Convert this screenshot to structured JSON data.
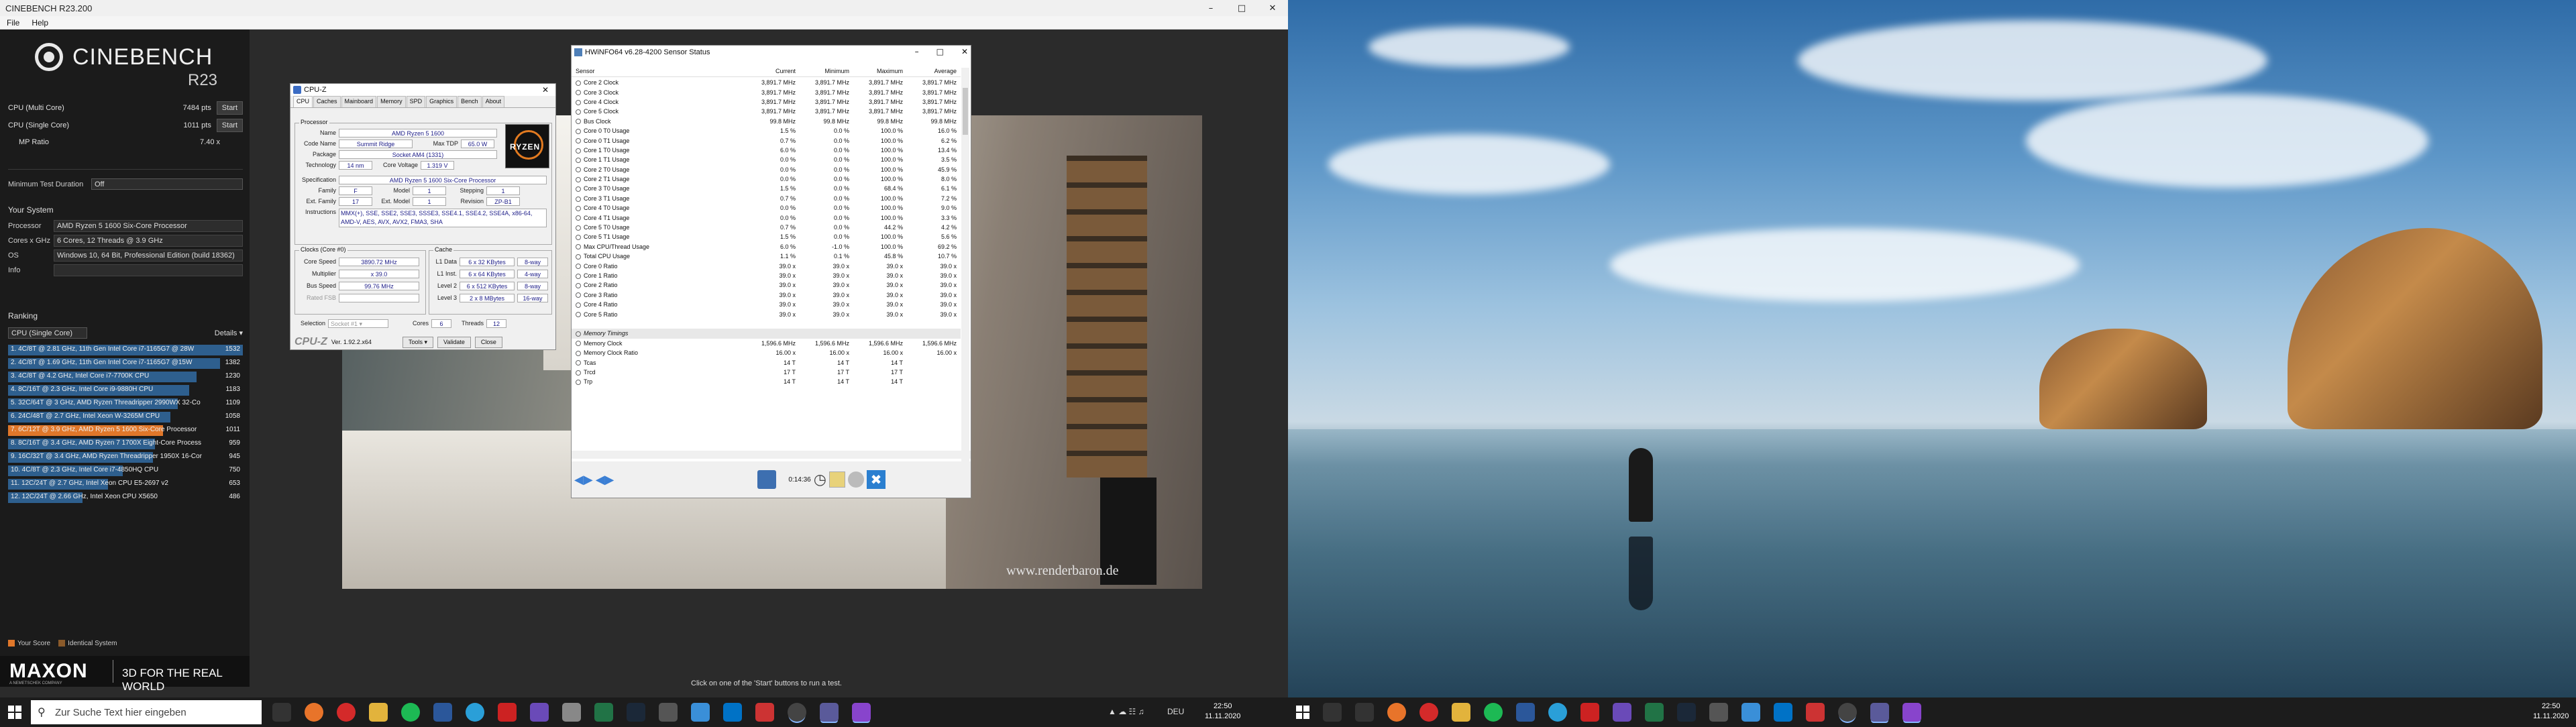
{
  "cinebench": {
    "window_title": "CINEBENCH R23.200",
    "menu": [
      "File",
      "Help"
    ],
    "logo_text": "CINEBENCH",
    "version": "R23",
    "multi_label": "CPU (Multi Core)",
    "multi_score": "7484 pts",
    "single_label": "CPU (Single Core)",
    "single_score": "1011 pts",
    "start_label": "Start",
    "mp_label": "MP Ratio",
    "mp_value": "7.40 x",
    "min_test_label": "Minimum Test Duration",
    "min_test_value": "Off",
    "your_system": "Your System",
    "system": [
      {
        "k": "Processor",
        "v": "AMD Ryzen 5 1600 Six-Core Processor"
      },
      {
        "k": "Cores x GHz",
        "v": "6 Cores, 12 Threads @ 3.9 GHz"
      },
      {
        "k": "OS",
        "v": "Windows 10, 64 Bit, Professional Edition (build 18362)"
      },
      {
        "k": "Info",
        "v": ""
      }
    ],
    "ranking_title": "Ranking",
    "ranking_select": "CPU (Single Core)",
    "details_label": "Details",
    "ranking": [
      {
        "text": "1. 4C/8T @ 2.81 GHz, 11th Gen Intel Core i7-1165G7 @ 28W",
        "score": 1532,
        "mine": false
      },
      {
        "text": "2. 4C/8T @ 1.69 GHz, 11th Gen Intel Core i7-1165G7 @15W",
        "score": 1382,
        "mine": false
      },
      {
        "text": "3. 4C/8T @ 4.2 GHz, Intel Core i7-7700K CPU",
        "score": 1230,
        "mine": false
      },
      {
        "text": "4. 8C/16T @ 2.3 GHz, Intel Core i9-9880H CPU",
        "score": 1183,
        "mine": false
      },
      {
        "text": "5. 32C/64T @ 3 GHz, AMD Ryzen Threadripper 2990WX 32-Co",
        "score": 1109,
        "mine": false
      },
      {
        "text": "6. 24C/48T @ 2.7 GHz, Intel Xeon W-3265M CPU",
        "score": 1058,
        "mine": false
      },
      {
        "text": "7. 6C/12T @ 3.9 GHz, AMD Ryzen 5 1600 Six-Core Processor",
        "score": 1011,
        "mine": true
      },
      {
        "text": "8. 8C/16T @ 3.4 GHz, AMD Ryzen 7 1700X Eight-Core Process",
        "score": 959,
        "mine": false
      },
      {
        "text": "9. 16C/32T @ 3.4 GHz, AMD Ryzen Threadripper 1950X 16-Cor",
        "score": 945,
        "mine": false
      },
      {
        "text": "10. 4C/8T @ 2.3 GHz, Intel Core i7-4850HQ CPU",
        "score": 750,
        "mine": false
      },
      {
        "text": "11. 12C/24T @ 2.7 GHz, Intel Xeon CPU E5-2697 v2",
        "score": 653,
        "mine": false
      },
      {
        "text": "12. 12C/24T @ 2.66 GHz, Intel Xeon CPU X5650",
        "score": 486,
        "mine": false
      }
    ],
    "legend_your": "Your Score",
    "legend_identical": "Identical System",
    "brand": "MAXON",
    "brand_sub": "A NEMETSCHEK COMPANY",
    "brand_tag": "3D FOR THE REAL WORLD",
    "status": "Click on one of the 'Start' buttons to run a test.",
    "watermark": "www.renderbaron.de",
    "colors": {
      "bar": "#2e5f8e",
      "mine": "#e0772a",
      "identical": "#8a5a2a"
    }
  },
  "cpuz": {
    "title": "CPU-Z",
    "tabs": [
      "CPU",
      "Caches",
      "Mainboard",
      "Memory",
      "SPD",
      "Graphics",
      "Bench",
      "About"
    ],
    "processor_group": "Processor",
    "name_label": "Name",
    "name": "AMD Ryzen 5 1600",
    "codename_label": "Code Name",
    "codename": "Summit Ridge",
    "maxtdp_label": "Max TDP",
    "maxtdp": "65.0 W",
    "package_label": "Package",
    "package": "Socket AM4 (1331)",
    "technology_label": "Technology",
    "technology": "14 nm",
    "corevoltage_label": "Core Voltage",
    "corevoltage": "1.319 V",
    "spec_label": "Specification",
    "spec": "AMD Ryzen 5 1600 Six-Core Processor",
    "family_label": "Family",
    "family": "F",
    "model_label": "Model",
    "model": "1",
    "stepping_label": "Stepping",
    "stepping": "1",
    "extfamily_label": "Ext. Family",
    "extfamily": "17",
    "extmodel_label": "Ext. Model",
    "extmodel": "1",
    "revision_label": "Revision",
    "revision": "ZP-B1",
    "instr_label": "Instructions",
    "instr": "MMX(+), SSE, SSE2, SSE3, SSSE3, SSE4.1, SSE4.2, SSE4A, x86-64, AMD-V, AES, AVX, AVX2, FMA3, SHA",
    "clocks_group": "Clocks (Core #0)",
    "corespeed_label": "Core Speed",
    "corespeed": "3890.72 MHz",
    "multiplier_label": "Multiplier",
    "multiplier": "x 39.0",
    "busspeed_label": "Bus Speed",
    "busspeed": "99.76 MHz",
    "ratedfsb_label": "Rated FSB",
    "cache_group": "Cache",
    "l1d_label": "L1 Data",
    "l1d": "6 x 32 KBytes",
    "l1d_way": "8-way",
    "l1i_label": "L1 Inst.",
    "l1i": "6 x 64 KBytes",
    "l1i_way": "4-way",
    "l2_label": "Level 2",
    "l2": "6 x 512 KBytes",
    "l2_way": "8-way",
    "l3_label": "Level 3",
    "l3": "2 x 8 MBytes",
    "l3_way": "16-way",
    "selection_label": "Selection",
    "selection": "Socket #1",
    "cores_label": "Cores",
    "cores": "6",
    "threads_label": "Threads",
    "threads": "12",
    "footer_logo": "CPU-Z",
    "version": "Ver. 1.92.2.x64",
    "tools_label": "Tools",
    "validate_label": "Validate",
    "close_label": "Close",
    "badge": "RYZEN"
  },
  "hwinfo": {
    "title": "HWiNFO64 v6.28-4200 Sensor Status",
    "headers": [
      "Sensor",
      "Current",
      "Minimum",
      "Maximum",
      "Average"
    ],
    "rows": [
      [
        "Core 2 Clock",
        "3,891.7 MHz",
        "3,891.7 MHz",
        "3,891.7 MHz",
        "3,891.7 MHz"
      ],
      [
        "Core 3 Clock",
        "3,891.7 MHz",
        "3,891.7 MHz",
        "3,891.7 MHz",
        "3,891.7 MHz"
      ],
      [
        "Core 4 Clock",
        "3,891.7 MHz",
        "3,891.7 MHz",
        "3,891.7 MHz",
        "3,891.7 MHz"
      ],
      [
        "Core 5 Clock",
        "3,891.7 MHz",
        "3,891.7 MHz",
        "3,891.7 MHz",
        "3,891.7 MHz"
      ],
      [
        "Bus Clock",
        "99.8 MHz",
        "99.8 MHz",
        "99.8 MHz",
        "99.8 MHz"
      ],
      [
        "Core 0 T0 Usage",
        "1.5 %",
        "0.0 %",
        "100.0 %",
        "16.0 %"
      ],
      [
        "Core 0 T1 Usage",
        "0.7 %",
        "0.0 %",
        "100.0 %",
        "6.2 %"
      ],
      [
        "Core 1 T0 Usage",
        "6.0 %",
        "0.0 %",
        "100.0 %",
        "13.4 %"
      ],
      [
        "Core 1 T1 Usage",
        "0.0 %",
        "0.0 %",
        "100.0 %",
        "3.5 %"
      ],
      [
        "Core 2 T0 Usage",
        "0.0 %",
        "0.0 %",
        "100.0 %",
        "45.9 %"
      ],
      [
        "Core 2 T1 Usage",
        "0.0 %",
        "0.0 %",
        "100.0 %",
        "8.0 %"
      ],
      [
        "Core 3 T0 Usage",
        "1.5 %",
        "0.0 %",
        "68.4 %",
        "6.1 %"
      ],
      [
        "Core 3 T1 Usage",
        "0.7 %",
        "0.0 %",
        "100.0 %",
        "7.2 %"
      ],
      [
        "Core 4 T0 Usage",
        "0.0 %",
        "0.0 %",
        "100.0 %",
        "9.0 %"
      ],
      [
        "Core 4 T1 Usage",
        "0.0 %",
        "0.0 %",
        "100.0 %",
        "3.3 %"
      ],
      [
        "Core 5 T0 Usage",
        "0.7 %",
        "0.0 %",
        "44.2 %",
        "4.2 %"
      ],
      [
        "Core 5 T1 Usage",
        "1.5 %",
        "0.0 %",
        "100.0 %",
        "5.6 %"
      ],
      [
        "Max CPU/Thread Usage",
        "6.0 %",
        "-1.0 %",
        "100.0 %",
        "69.2 %"
      ],
      [
        "Total CPU Usage",
        "1.1 %",
        "0.1 %",
        "45.8 %",
        "10.7 %"
      ],
      [
        "Core 0 Ratio",
        "39.0 x",
        "39.0 x",
        "39.0 x",
        "39.0 x"
      ],
      [
        "Core 1 Ratio",
        "39.0 x",
        "39.0 x",
        "39.0 x",
        "39.0 x"
      ],
      [
        "Core 2 Ratio",
        "39.0 x",
        "39.0 x",
        "39.0 x",
        "39.0 x"
      ],
      [
        "Core 3 Ratio",
        "39.0 x",
        "39.0 x",
        "39.0 x",
        "39.0 x"
      ],
      [
        "Core 4 Ratio",
        "39.0 x",
        "39.0 x",
        "39.0 x",
        "39.0 x"
      ],
      [
        "Core 5 Ratio",
        "39.0 x",
        "39.0 x",
        "39.0 x",
        "39.0 x"
      ],
      [
        "",
        "",
        "",
        "",
        ""
      ],
      [
        "Memory Timings",
        "",
        "",
        "",
        ""
      ],
      [
        "Memory Clock",
        "1,596.6 MHz",
        "1,596.6 MHz",
        "1,596.6 MHz",
        "1,596.6 MHz"
      ],
      [
        "Memory Clock Ratio",
        "16.00 x",
        "16.00 x",
        "16.00 x",
        "16.00 x"
      ],
      [
        "Tcas",
        "14 T",
        "14 T",
        "14 T",
        ""
      ],
      [
        "Trcd",
        "17 T",
        "17 T",
        "17 T",
        ""
      ],
      [
        "Trp",
        "14 T",
        "14 T",
        "14 T",
        ""
      ]
    ],
    "section_row_index": 26,
    "elapsed": "0:14:36"
  },
  "taskbar1": {
    "search_placeholder": "Zur Suche Text hier eingeben",
    "lang": "DEU",
    "time": "22:50",
    "date": "11.11.2020"
  },
  "taskbar2": {
    "time": "22:50",
    "date": "11.11.2020"
  }
}
